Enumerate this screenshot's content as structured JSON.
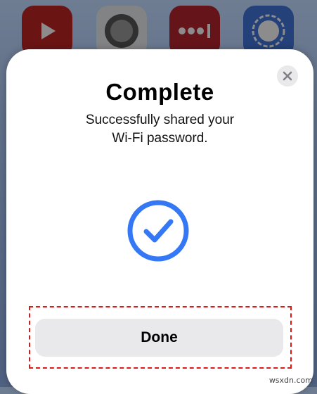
{
  "home_screen": {
    "apps": [
      {
        "icon": "youtube-icon"
      },
      {
        "icon": "authenticator-icon"
      },
      {
        "icon": "lastpass-icon"
      },
      {
        "icon": "signal-icon"
      }
    ]
  },
  "dialog": {
    "title": "Complete",
    "message_line1": "Successfully shared your",
    "message_line2": "Wi-Fi password.",
    "close_icon": "close-icon",
    "status_icon": "checkmark-circle-icon",
    "done_label": "Done"
  },
  "colors": {
    "accent": "#3478f6",
    "highlight": "#e01818",
    "button_bg": "#e9e9eb"
  },
  "watermark": "wsxdn.com"
}
